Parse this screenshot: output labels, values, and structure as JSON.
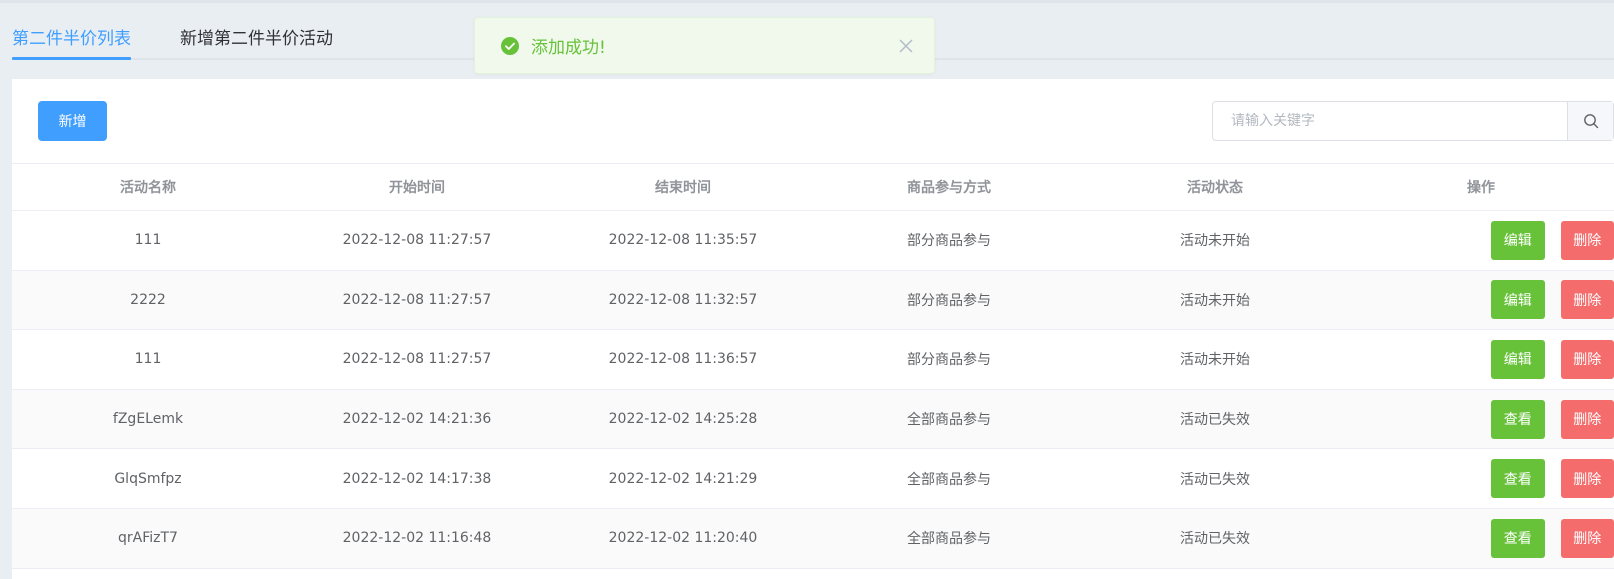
{
  "tabs": [
    {
      "label": "第二件半价列表",
      "active": true
    },
    {
      "label": "新增第二件半价活动",
      "active": false
    }
  ],
  "toast": {
    "message": "添加成功!",
    "type": "success"
  },
  "toolbar": {
    "add_label": "新增"
  },
  "search": {
    "placeholder": "请输入关键字",
    "value": ""
  },
  "table": {
    "headers": [
      "活动名称",
      "开始时间",
      "结束时间",
      "商品参与方式",
      "活动状态",
      "操作"
    ],
    "rows": [
      {
        "name": "111",
        "start": "2022-12-08 11:27:57",
        "end": "2022-12-08 11:35:57",
        "mode": "部分商品参与",
        "status": "活动未开始",
        "action": "编辑",
        "delete": "删除"
      },
      {
        "name": "2222",
        "start": "2022-12-08 11:27:57",
        "end": "2022-12-08 11:32:57",
        "mode": "部分商品参与",
        "status": "活动未开始",
        "action": "编辑",
        "delete": "删除"
      },
      {
        "name": "111",
        "start": "2022-12-08 11:27:57",
        "end": "2022-12-08 11:36:57",
        "mode": "部分商品参与",
        "status": "活动未开始",
        "action": "编辑",
        "delete": "删除"
      },
      {
        "name": "fZgELemk",
        "start": "2022-12-02 14:21:36",
        "end": "2022-12-02 14:25:28",
        "mode": "全部商品参与",
        "status": "活动已失效",
        "action": "查看",
        "delete": "删除"
      },
      {
        "name": "GlqSmfpz",
        "start": "2022-12-02 14:17:38",
        "end": "2022-12-02 14:21:29",
        "mode": "全部商品参与",
        "status": "活动已失效",
        "action": "查看",
        "delete": "删除"
      },
      {
        "name": "qrAFizT7",
        "start": "2022-12-02 11:16:48",
        "end": "2022-12-02 11:20:40",
        "mode": "全部商品参与",
        "status": "活动已失效",
        "action": "查看",
        "delete": "删除"
      }
    ]
  },
  "colors": {
    "primary": "#409eff",
    "success": "#67c23a",
    "danger": "#f56c6c"
  }
}
